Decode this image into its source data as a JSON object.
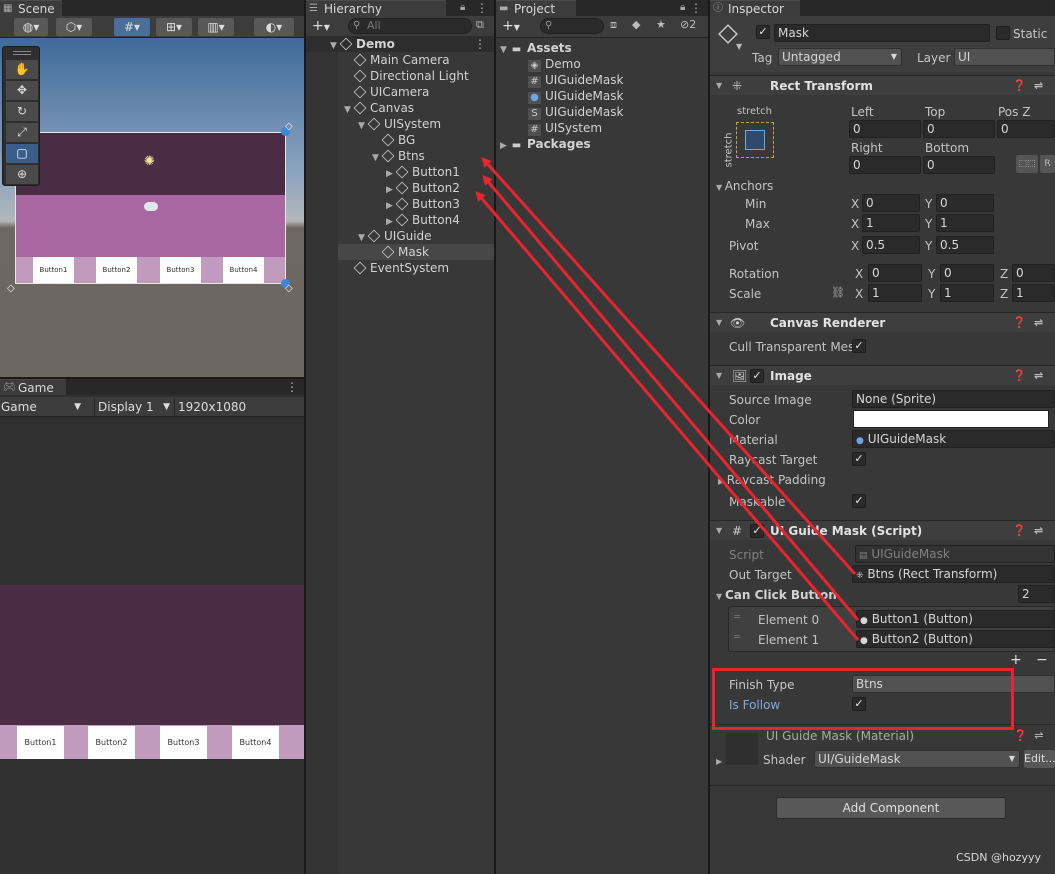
{
  "scene": {
    "tab": "Scene",
    "canvas_buttons": [
      "Button1",
      "Button2",
      "Button3",
      "Button4"
    ]
  },
  "game": {
    "tab": "Game",
    "mode": "Game",
    "display": "Display 1",
    "resolution": "1920x1080",
    "buttons": [
      "Button1",
      "Button2",
      "Button3",
      "Button4"
    ]
  },
  "hierarchy": {
    "tab": "Hierarchy",
    "search_placeholder": "All",
    "items": [
      {
        "label": "Demo",
        "depth": 0,
        "arrow": "▼",
        "bold": true
      },
      {
        "label": "Main Camera",
        "depth": 1,
        "arrow": ""
      },
      {
        "label": "Directional Light",
        "depth": 1,
        "arrow": ""
      },
      {
        "label": "UICamera",
        "depth": 1,
        "arrow": ""
      },
      {
        "label": "Canvas",
        "depth": 1,
        "arrow": "▼"
      },
      {
        "label": "UISystem",
        "depth": 2,
        "arrow": "▼"
      },
      {
        "label": "BG",
        "depth": 3,
        "arrow": ""
      },
      {
        "label": "Btns",
        "depth": 3,
        "arrow": "▼"
      },
      {
        "label": "Button1",
        "depth": 4,
        "arrow": "▶"
      },
      {
        "label": "Button2",
        "depth": 4,
        "arrow": "▶"
      },
      {
        "label": "Button3",
        "depth": 4,
        "arrow": "▶"
      },
      {
        "label": "Button4",
        "depth": 4,
        "arrow": "▶"
      },
      {
        "label": "UIGuide",
        "depth": 2,
        "arrow": "▼"
      },
      {
        "label": "Mask",
        "depth": 3,
        "arrow": "",
        "selected": true
      },
      {
        "label": "EventSystem",
        "depth": 1,
        "arrow": ""
      }
    ]
  },
  "project": {
    "tab": "Project",
    "badge": "2",
    "items": [
      {
        "label": "Assets",
        "icon": "folder-icon",
        "depth": 0,
        "arrow": "▼",
        "bold": true
      },
      {
        "label": "Demo",
        "icon": "unity-scene-icon",
        "depth": 1
      },
      {
        "label": "UIGuideMask",
        "icon": "script-icon",
        "depth": 1
      },
      {
        "label": "UIGuideMask",
        "icon": "material-icon",
        "depth": 1
      },
      {
        "label": "UIGuideMask",
        "icon": "shader-icon",
        "depth": 1
      },
      {
        "label": "UISystem",
        "icon": "script-icon",
        "depth": 1
      },
      {
        "label": "Packages",
        "icon": "folder-icon",
        "depth": 0,
        "arrow": "▶",
        "bold": true
      }
    ]
  },
  "inspector": {
    "tab": "Inspector",
    "object_name": "Mask",
    "static_label": "Static",
    "tag_label": "Tag",
    "tag_value": "Untagged",
    "layer_label": "Layer",
    "layer_value": "UI",
    "rect_transform": {
      "title": "Rect Transform",
      "stretch": "stretch",
      "stretch_v": "stretch",
      "left_label": "Left",
      "top_label": "Top",
      "posz_label": "Pos Z",
      "left": "0",
      "top": "0",
      "posz": "0",
      "right_label": "Right",
      "bottom_label": "Bottom",
      "right": "0",
      "bottom": "0",
      "anchors_label": "Anchors",
      "min_label": "Min",
      "max_label": "Max",
      "min_x": "0",
      "min_y": "0",
      "max_x": "1",
      "max_y": "1",
      "pivot_label": "Pivot",
      "pivot_x": "0.5",
      "pivot_y": "0.5",
      "rotation_label": "Rotation",
      "rot_x": "0",
      "rot_y": "0",
      "rot_z": "0",
      "scale_label": "Scale",
      "scale_x": "1",
      "scale_y": "1",
      "scale_z": "1",
      "x": "X",
      "y": "Y",
      "z": "Z"
    },
    "canvas_renderer": {
      "title": "Canvas Renderer",
      "cull_label": "Cull Transparent Mesl"
    },
    "image": {
      "title": "Image",
      "source_label": "Source Image",
      "source_value": "None (Sprite)",
      "color_label": "Color",
      "material_label": "Material",
      "material_value": "UIGuideMask",
      "raycast_label": "Raycast Target",
      "padding_label": "Raycast Padding",
      "maskable_label": "Maskable"
    },
    "script": {
      "title": "UI Guide Mask (Script)",
      "script_label": "Script",
      "script_value": "UIGuideMask",
      "out_target_label": "Out Target",
      "out_target_value": "Btns (Rect Transform)",
      "can_click_label": "Can Click Button",
      "can_click_count": "2",
      "elements": [
        {
          "label": "Element 0",
          "value": "Button1 (Button)"
        },
        {
          "label": "Element 1",
          "value": "Button2 (Button)"
        }
      ],
      "plus": "+",
      "minus": "−",
      "finish_type_label": "Finish Type",
      "finish_type_value": "Btns",
      "is_follow_label": "Is Follow"
    },
    "material": {
      "title": "UI Guide Mask (Material)",
      "shader_label": "Shader",
      "shader_value": "UI/GuideMask",
      "edit_label": "Edit..."
    },
    "add_component": "Add Component"
  },
  "watermark": "CSDN @hozyyy",
  "colors": {
    "accent_blue": "#4c8fd8",
    "annotation_red": "#e8242d",
    "scene_purple_dark": "#4a2c45",
    "scene_purple_light": "#a967a2"
  }
}
